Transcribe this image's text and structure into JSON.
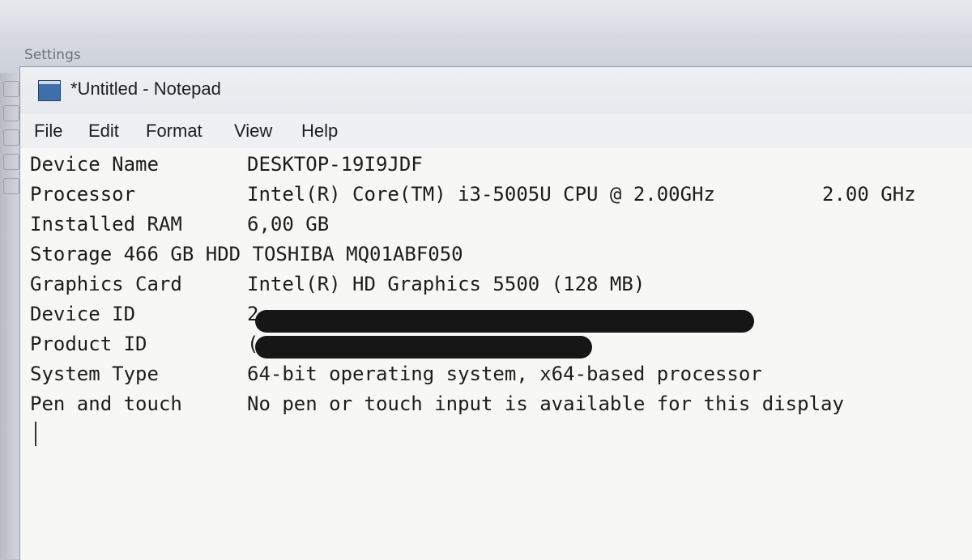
{
  "background": {
    "settings_title": "Settings"
  },
  "window": {
    "title": "*Untitled - Notepad"
  },
  "menu": [
    "File",
    "Edit",
    "Format",
    "View",
    "Help"
  ],
  "content": {
    "rows": [
      {
        "label": "Device Name",
        "value": "DESKTOP-19I9JDF"
      },
      {
        "label": "Processor",
        "value": "Intel(R) Core(TM) i3-5005U CPU @ 2.00GHz",
        "value2": "2.00 GHz"
      },
      {
        "label": "Installed RAM",
        "value": "6,00 GB"
      },
      {
        "label": "Storage 466 GB HDD TOSHIBA MQ01ABF050"
      },
      {
        "label": "Graphics Card",
        "value": "Intel(R) HD Graphics 5500 (128 MB)"
      },
      {
        "label": "Device ID",
        "value": "2"
      },
      {
        "label": "Product ID",
        "value": "("
      },
      {
        "label": "System Type",
        "value": "64-bit operating system, x64-based processor"
      },
      {
        "label": "Pen and touch",
        "value": "No pen or touch input is available for this display"
      }
    ]
  }
}
